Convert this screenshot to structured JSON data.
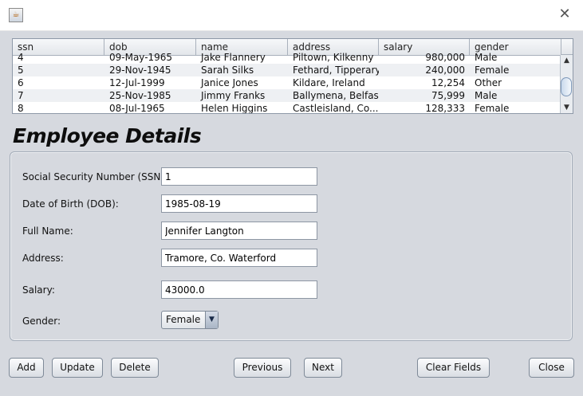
{
  "window": {
    "close_glyph": "✕",
    "app_icon": "java-cup-icon"
  },
  "table": {
    "columns": [
      "ssn",
      "dob",
      "name",
      "address",
      "salary",
      "gender"
    ],
    "rows": [
      [
        "4",
        "09-May-1965",
        "Jake Flannery",
        "Piltown, Kilkenny",
        "980,000",
        "Male"
      ],
      [
        "5",
        "29-Nov-1945",
        "Sarah Silks",
        "Fethard, Tipperary",
        "240,000",
        "Female"
      ],
      [
        "6",
        "12-Jul-1999",
        "Janice Jones",
        "Kildare, Ireland",
        "12,254",
        "Other"
      ],
      [
        "7",
        "25-Nov-1985",
        "Jimmy Franks",
        "Ballymena, Belfast",
        "75,999",
        "Male"
      ],
      [
        "8",
        "08-Jul-1965",
        "Helen Higgins",
        "Castleisland, Co....",
        "128,333",
        "Female"
      ]
    ],
    "scroll_up": "▲",
    "scroll_down": "▼"
  },
  "details": {
    "heading": "Employee Details",
    "ssn_label": "Social Security Number (SSN):",
    "ssn_value": "1",
    "dob_label": "Date of Birth (DOB):",
    "dob_value": "1985-08-19",
    "name_label": "Full Name:",
    "name_value": "Jennifer Langton",
    "address_label": "Address:",
    "address_value": "Tramore, Co. Waterford",
    "salary_label": "Salary:",
    "salary_value": "43000.0",
    "gender_label": "Gender:",
    "gender_value": "Female",
    "gender_arrow": "▼"
  },
  "buttons": {
    "add": "Add",
    "update": "Update",
    "delete": "Delete",
    "previous": "Previous",
    "next": "Next",
    "clear": "Clear Fields",
    "close": "Close"
  }
}
